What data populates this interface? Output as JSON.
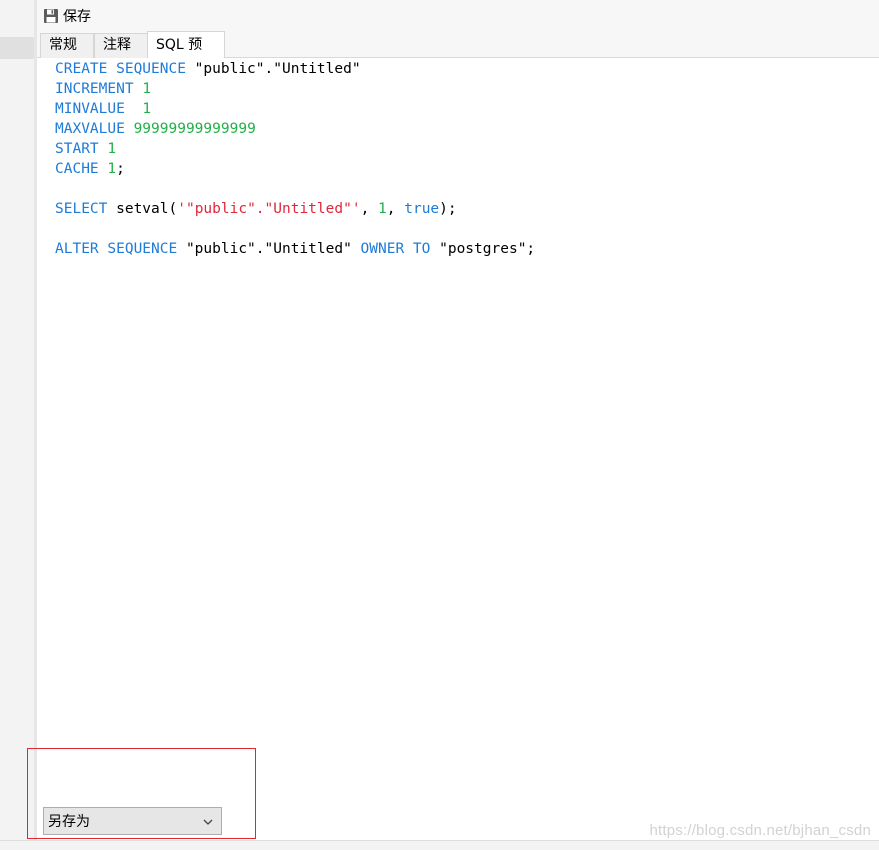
{
  "toolbar": {
    "save_label": "保存",
    "save_icon": "floppy-disk-icon"
  },
  "tabs": [
    {
      "label": "常规",
      "active": false
    },
    {
      "label": "注释",
      "active": false
    },
    {
      "label": "SQL 预览",
      "active": true
    }
  ],
  "sql_preview": {
    "lines": [
      [
        {
          "t": "kw",
          "v": "CREATE SEQUENCE"
        },
        {
          "t": "plain",
          "v": " \"public\".\"Untitled\""
        }
      ],
      [
        {
          "t": "kw",
          "v": "INCREMENT"
        },
        {
          "t": "plain",
          "v": " "
        },
        {
          "t": "num",
          "v": "1"
        }
      ],
      [
        {
          "t": "kw",
          "v": "MINVALUE"
        },
        {
          "t": "plain",
          "v": "  "
        },
        {
          "t": "num",
          "v": "1"
        }
      ],
      [
        {
          "t": "kw",
          "v": "MAXVALUE"
        },
        {
          "t": "plain",
          "v": " "
        },
        {
          "t": "num",
          "v": "99999999999999"
        }
      ],
      [
        {
          "t": "kw",
          "v": "START"
        },
        {
          "t": "plain",
          "v": " "
        },
        {
          "t": "num",
          "v": "1"
        }
      ],
      [
        {
          "t": "kw",
          "v": "CACHE"
        },
        {
          "t": "plain",
          "v": " "
        },
        {
          "t": "num",
          "v": "1"
        },
        {
          "t": "plain",
          "v": ";"
        }
      ],
      [],
      [
        {
          "t": "kw",
          "v": "SELECT"
        },
        {
          "t": "plain",
          "v": " setval("
        },
        {
          "t": "str",
          "v": "'\"public\".\"Untitled\"'"
        },
        {
          "t": "plain",
          "v": ", "
        },
        {
          "t": "num",
          "v": "1"
        },
        {
          "t": "plain",
          "v": ", "
        },
        {
          "t": "kw",
          "v": "true"
        },
        {
          "t": "plain",
          "v": ");"
        }
      ],
      [],
      [
        {
          "t": "kw",
          "v": "ALTER SEQUENCE"
        },
        {
          "t": "plain",
          "v": " \"public\".\"Untitled\" "
        },
        {
          "t": "kw",
          "v": "OWNER TO"
        },
        {
          "t": "plain",
          "v": " \"postgres\";"
        }
      ]
    ]
  },
  "footer": {
    "save_as_selected": "另存为",
    "dropdown_icon": "chevron-down-icon"
  },
  "watermark": "https://blog.csdn.net/bjhan_csdn",
  "colors": {
    "keyword": "#1e7bd8",
    "number": "#22b04a",
    "string": "#e0283c",
    "highlight_box": "#e0262e"
  }
}
